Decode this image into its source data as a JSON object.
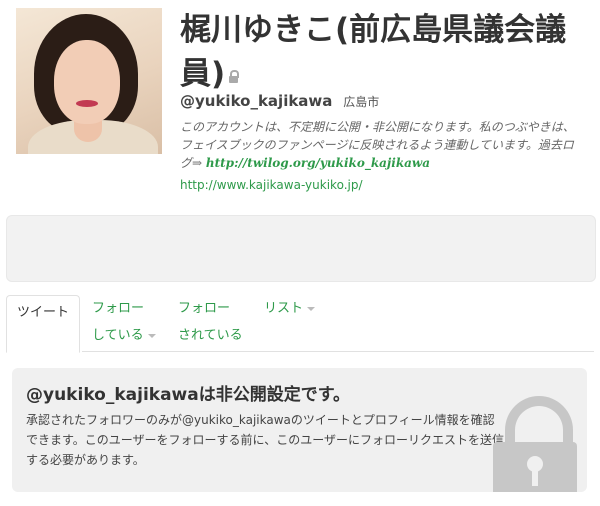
{
  "profile": {
    "name": "梶川ゆきこ(前広島県議会議員)",
    "handle": "@yukiko_kajikawa",
    "location": "広島市",
    "bio_text": "このアカウントは、不定期に公開・非公開になります。私のつぶやきは、フェイスブックのファンページに反映されるよう連動しています。過去ログ⇒ ",
    "bio_link": "http://twilog.org/yukiko_kajikawa",
    "website": "http://www.kajikawa-yukiko.jp/",
    "lock_icon": "lock-icon",
    "avatar_icon": "profile-photo"
  },
  "tabs": {
    "tweets": "ツイート",
    "following_1": "フォロー",
    "following_2": "している",
    "followers_1": "フォロー",
    "followers_2": "されている",
    "lists": "リスト"
  },
  "notice": {
    "title": "@yukiko_kajikawaは非公開設定です。",
    "body": "承認されたフォロワーのみが@yukiko_kajikawaのツイートとプロフィール情報を確認できます。このユーザーをフォローする前に、このユーザーにフォローリクエストを送信する必要があります。",
    "icon": "padlock-icon"
  },
  "colors": {
    "link": "#2e9a4a",
    "panel": "#f0f0f0"
  }
}
